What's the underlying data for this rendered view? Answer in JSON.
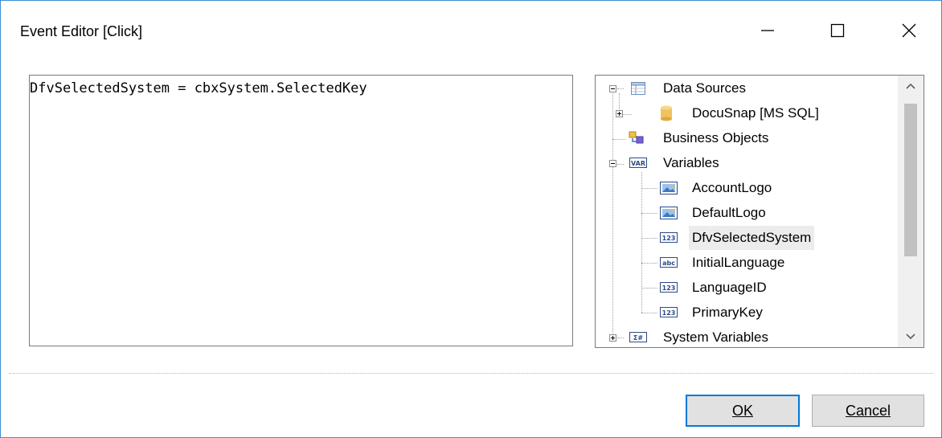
{
  "window": {
    "title": "Event Editor [Click]",
    "controls": {
      "minimize_icon": "minimize-icon",
      "maximize_icon": "maximize-icon",
      "close_icon": "close-icon"
    }
  },
  "editor": {
    "code": "DfvSelectedSystem = cbxSystem.SelectedKey"
  },
  "tree": {
    "data_sources": {
      "label": "Data Sources",
      "expanded": true
    },
    "docusnap": {
      "label": "DocuSnap [MS SQL]",
      "expanded": false
    },
    "business_objects": {
      "label": "Business Objects"
    },
    "variables": {
      "label": "Variables",
      "badge": "VAR",
      "expanded": true
    },
    "items": [
      {
        "label": "AccountLogo",
        "badge": "img"
      },
      {
        "label": "DefaultLogo",
        "badge": "img"
      },
      {
        "label": "DfvSelectedSystem",
        "badge": "123",
        "selected": true
      },
      {
        "label": "InitialLanguage",
        "badge": "abc"
      },
      {
        "label": "LanguageID",
        "badge": "123"
      },
      {
        "label": "PrimaryKey",
        "badge": "123"
      }
    ],
    "system_variables": {
      "label": "System Variables",
      "badge": "Σ#",
      "expanded": false
    }
  },
  "buttons": {
    "ok_label": "OK",
    "cancel_label": "Cancel"
  },
  "colors": {
    "accent": "#0078d7",
    "window_border": "#3c8fd6",
    "selection": "#ececec"
  }
}
